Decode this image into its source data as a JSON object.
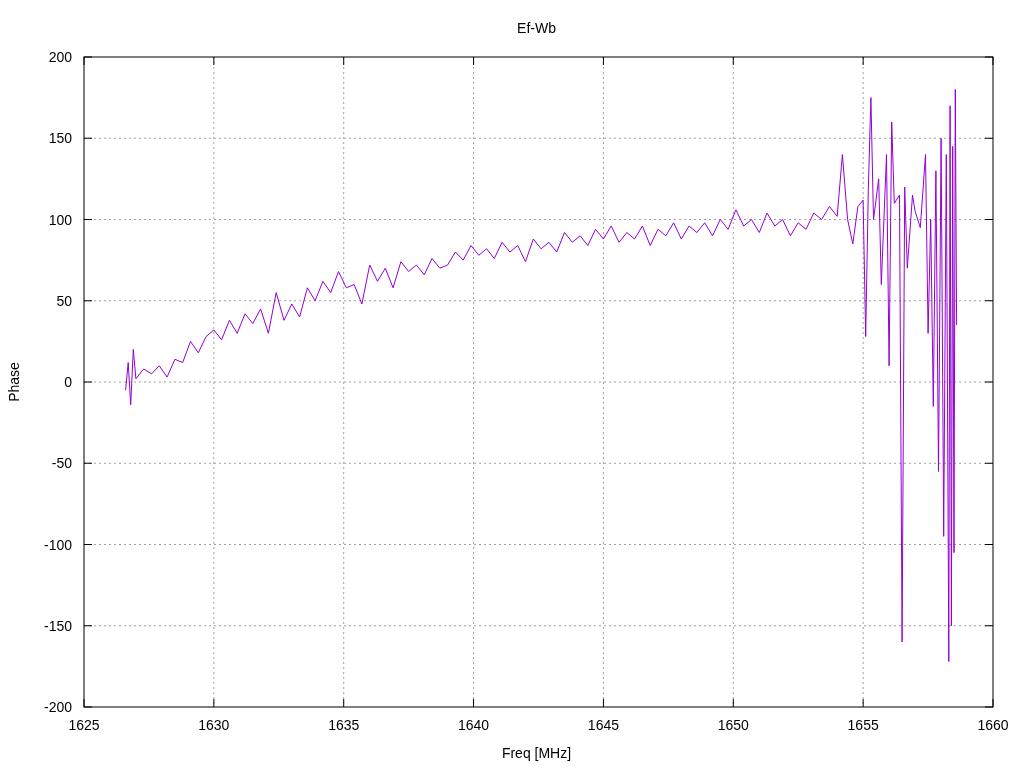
{
  "chart_data": {
    "type": "line",
    "title": "Ef-Wb",
    "xlabel": "Freq [MHz]",
    "ylabel": "Phase",
    "xlim": [
      1625,
      1660
    ],
    "ylim": [
      -200,
      200
    ],
    "grid": true,
    "xticks": [
      1625,
      1630,
      1635,
      1640,
      1645,
      1650,
      1655,
      1660
    ],
    "yticks": [
      -200,
      -150,
      -100,
      -50,
      0,
      50,
      100,
      150,
      200
    ],
    "x": [
      1626.6,
      1626.7,
      1626.8,
      1626.9,
      1627.0,
      1627.3,
      1627.6,
      1627.9,
      1628.2,
      1628.5,
      1628.8,
      1629.1,
      1629.4,
      1629.7,
      1630.0,
      1630.3,
      1630.6,
      1630.9,
      1631.2,
      1631.5,
      1631.8,
      1632.1,
      1632.4,
      1632.7,
      1633.0,
      1633.3,
      1633.6,
      1633.9,
      1634.2,
      1634.5,
      1634.8,
      1635.1,
      1635.4,
      1635.7,
      1636.0,
      1636.3,
      1636.6,
      1636.9,
      1637.2,
      1637.5,
      1637.8,
      1638.1,
      1638.4,
      1638.7,
      1639.0,
      1639.3,
      1639.6,
      1639.9,
      1640.2,
      1640.5,
      1640.8,
      1641.1,
      1641.4,
      1641.7,
      1642.0,
      1642.3,
      1642.6,
      1642.9,
      1643.2,
      1643.5,
      1643.8,
      1644.1,
      1644.4,
      1644.7,
      1645.0,
      1645.3,
      1645.6,
      1645.9,
      1646.2,
      1646.5,
      1646.8,
      1647.1,
      1647.4,
      1647.7,
      1648.0,
      1648.3,
      1648.6,
      1648.9,
      1649.2,
      1649.5,
      1649.8,
      1650.1,
      1650.4,
      1650.7,
      1651.0,
      1651.3,
      1651.6,
      1651.9,
      1652.2,
      1652.5,
      1652.8,
      1653.1,
      1653.4,
      1653.7,
      1654.0,
      1654.2,
      1654.4,
      1654.6,
      1654.8,
      1655.0,
      1655.1,
      1655.2,
      1655.3,
      1655.4,
      1655.6,
      1655.7,
      1655.9,
      1656.0,
      1656.1,
      1656.2,
      1656.4,
      1656.5,
      1656.6,
      1656.7,
      1656.9,
      1657.0,
      1657.2,
      1657.4,
      1657.5,
      1657.6,
      1657.7,
      1657.8,
      1657.9,
      1658.0,
      1658.1,
      1658.2,
      1658.3,
      1658.35,
      1658.4,
      1658.45,
      1658.5,
      1658.55,
      1658.6
    ],
    "series": [
      {
        "color": "#9400d3",
        "values": [
          -5,
          12,
          -14,
          20,
          2,
          8,
          5,
          10,
          3,
          14,
          12,
          25,
          18,
          28,
          32,
          26,
          38,
          30,
          42,
          36,
          45,
          30,
          55,
          38,
          48,
          40,
          58,
          50,
          62,
          55,
          68,
          58,
          60,
          48,
          72,
          62,
          70,
          58,
          74,
          68,
          72,
          66,
          76,
          70,
          72,
          80,
          75,
          84,
          78,
          82,
          76,
          86,
          80,
          84,
          74,
          88,
          82,
          86,
          80,
          92,
          86,
          90,
          84,
          94,
          88,
          96,
          86,
          92,
          88,
          96,
          84,
          94,
          90,
          98,
          88,
          96,
          92,
          98,
          90,
          100,
          94,
          106,
          96,
          100,
          92,
          104,
          96,
          100,
          90,
          98,
          94,
          104,
          100,
          108,
          102,
          140,
          100,
          85,
          108,
          112,
          28,
          118,
          175,
          100,
          125,
          60,
          140,
          10,
          160,
          110,
          115,
          -160,
          120,
          70,
          115,
          105,
          95,
          140,
          30,
          100,
          -15,
          130,
          -55,
          150,
          -95,
          140,
          -172,
          170,
          -150,
          145,
          -105,
          180,
          35
        ]
      }
    ]
  }
}
